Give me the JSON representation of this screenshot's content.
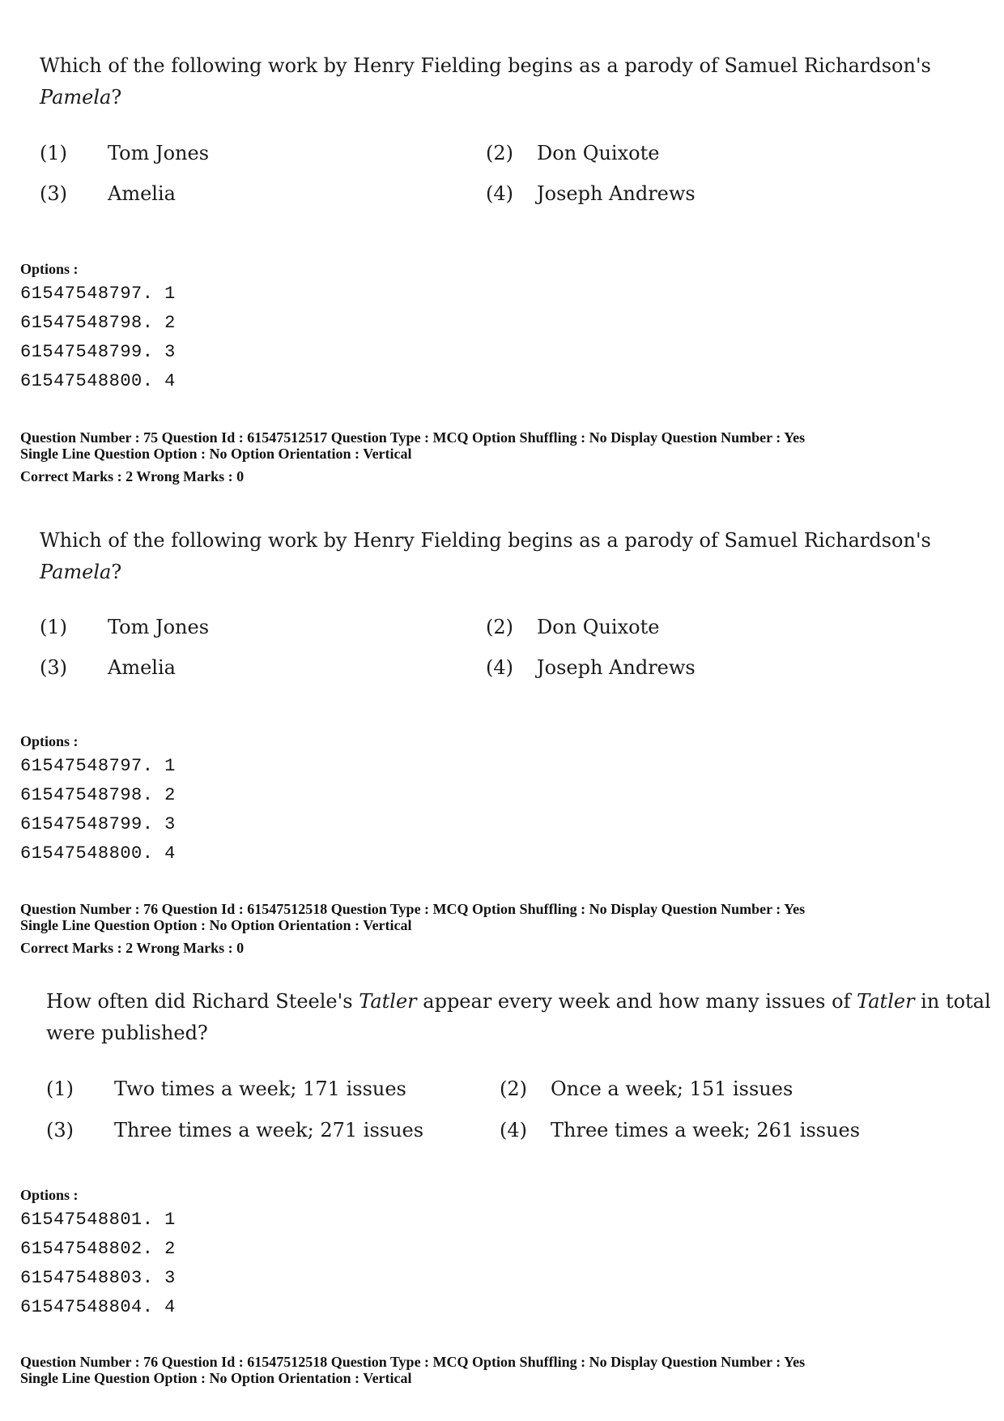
{
  "blocks": [
    {
      "question": {
        "text_before": "Which of the following work by Henry Fielding begins as a parody of Samuel Richardson's",
        "italic": "Pamela",
        "text_after": "?",
        "choices": [
          {
            "num": "(1)",
            "text": "Tom Jones"
          },
          {
            "num": "(2)",
            "text": "Don Quixote"
          },
          {
            "num": "(3)",
            "text": "Amelia"
          },
          {
            "num": "(4)",
            "text": "Joseph Andrews"
          }
        ]
      },
      "options_label": "Options :",
      "option_ids": [
        "61547548797. 1",
        "61547548798. 2",
        "61547548799. 3",
        "61547548800. 4"
      ],
      "meta": {
        "line1": "Question Number : 75  Question Id : 61547512517  Question Type : MCQ  Option Shuffling : No  Display Question Number : Yes",
        "line2": "Single Line Question Option : No  Option Orientation : Vertical",
        "line3": "Correct Marks : 2  Wrong Marks : 0"
      }
    },
    {
      "question": {
        "text_before": "Which of the following work by Henry Fielding begins as a parody of Samuel Richardson's",
        "italic": "Pamela",
        "text_after": "?",
        "choices": [
          {
            "num": "(1)",
            "text": "Tom Jones"
          },
          {
            "num": "(2)",
            "text": "Don Quixote"
          },
          {
            "num": "(3)",
            "text": "Amelia"
          },
          {
            "num": "(4)",
            "text": "Joseph Andrews"
          }
        ]
      },
      "options_label": "Options :",
      "option_ids": [
        "61547548797. 1",
        "61547548798. 2",
        "61547548799. 3",
        "61547548800. 4"
      ],
      "meta": {
        "line1": "Question Number : 76  Question Id : 61547512518  Question Type : MCQ  Option Shuffling : No  Display Question Number : Yes",
        "line2": "Single Line Question Option : No  Option Orientation : Vertical",
        "line3": "Correct Marks : 2  Wrong Marks : 0"
      }
    },
    {
      "question": {
        "text_a": "How often did Richard Steele's ",
        "italic_a": "Tatler",
        "text_b": " appear every week and how many issues of ",
        "italic_b": "Tatler",
        "text_c": " in total were published?",
        "choices": [
          {
            "num": "(1)",
            "text": "Two times a week; 171 issues"
          },
          {
            "num": "(2)",
            "text": "Once a week; 151 issues"
          },
          {
            "num": "(3)",
            "text": "Three times a week; 271 issues"
          },
          {
            "num": "(4)",
            "text": "Three times a week; 261 issues"
          }
        ]
      },
      "options_label": "Options :",
      "option_ids": [
        "61547548801. 1",
        "61547548802. 2",
        "61547548803. 3",
        "61547548804. 4"
      ],
      "meta": {
        "line1": "Question Number : 76  Question Id : 61547512518  Question Type : MCQ  Option Shuffling : No  Display Question Number : Yes",
        "line2": "Single Line Question Option : No  Option Orientation : Vertical"
      }
    }
  ]
}
